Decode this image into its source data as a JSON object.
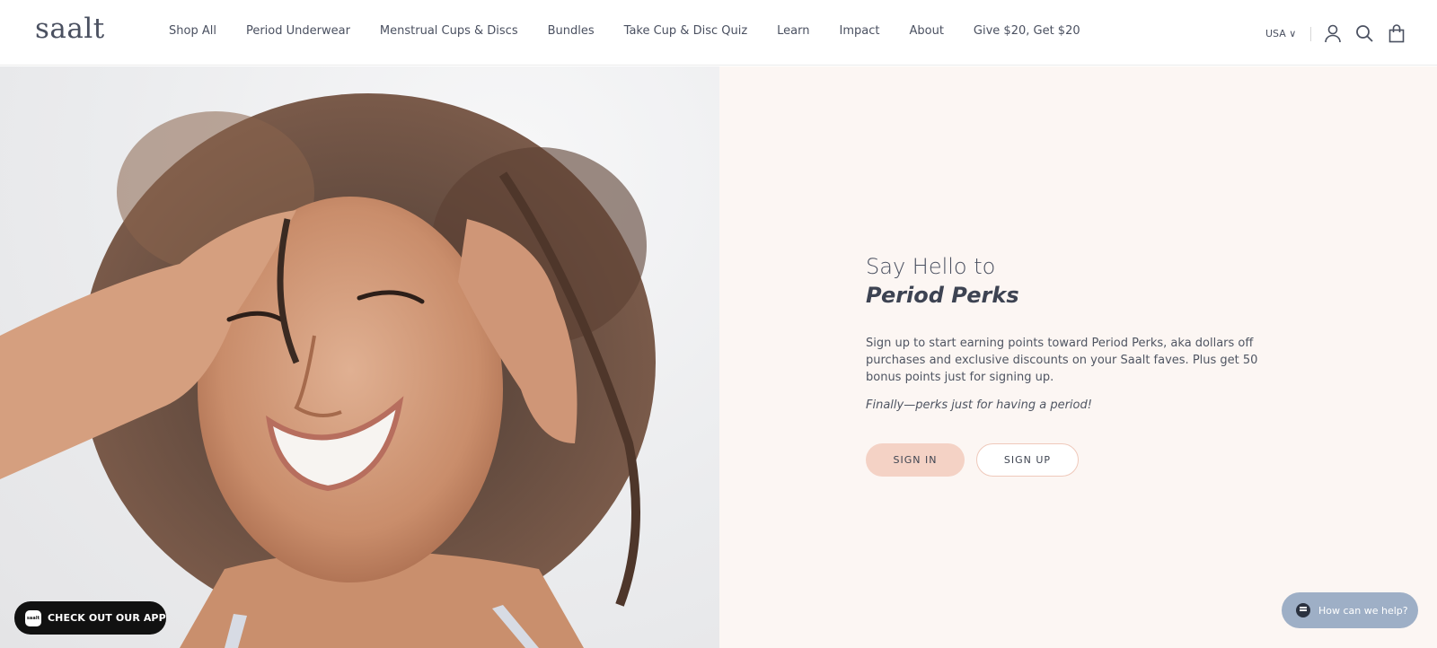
{
  "header": {
    "logo": "saalt",
    "nav": [
      {
        "label": "Shop All"
      },
      {
        "label": "Period Underwear"
      },
      {
        "label": "Menstrual Cups & Discs"
      },
      {
        "label": "Bundles"
      },
      {
        "label": "Take Cup & Disc Quiz"
      },
      {
        "label": "Learn"
      },
      {
        "label": "Impact"
      },
      {
        "label": "About"
      },
      {
        "label": "Give $20, Get $20"
      }
    ],
    "country": "USA ∨"
  },
  "hero": {
    "headline_line1": "Say Hello to",
    "headline_line2": "Period Perks",
    "description": "Sign up to start earning points toward Period Perks, aka dollars off purchases and exclusive discounts on your Saalt faves. Plus get 50 bonus points just for signing up.",
    "tagline": "Finally—perks just for having a period!",
    "signin_label": "SIGN IN",
    "signup_label": "SIGN UP"
  },
  "app_badge": {
    "label": "CHECK OUT OUR APP",
    "icon_text": "saalt"
  },
  "help": {
    "label": "How can we help?"
  },
  "colors": {
    "panel_bg": "#fcf6f3",
    "signin_bg": "#f4d2c5",
    "signup_border": "#efc9bb",
    "help_bg": "#9eafc6",
    "text": "#3e4451"
  }
}
